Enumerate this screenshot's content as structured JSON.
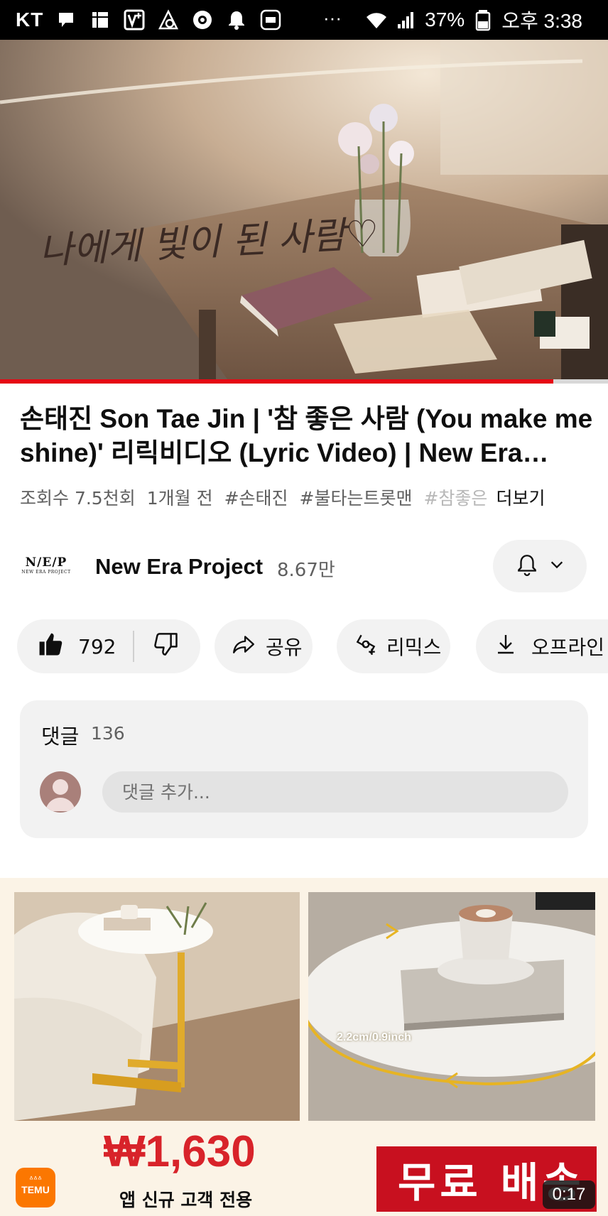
{
  "status_bar": {
    "carrier": "KT",
    "dots": "···",
    "battery": "37%",
    "time": "오후 3:38"
  },
  "video": {
    "overlay_text": "나에게 빛이 된 사람♡",
    "progress": 0.91
  },
  "title": "손태진 Son Tae Jin | '참 좋은 사람 (You make me shine)' 리릭비디오 (Lyric Video) | New Era Project",
  "meta": {
    "views": "조회수 7.5천회",
    "age": "1개월 전",
    "tags": [
      "#손태진",
      "#불타는트롯맨"
    ],
    "tag_faded": "#참좋은",
    "more": "더보기"
  },
  "channel": {
    "logo_text": "N/E/P",
    "logo_subtext": "NEW ERA PROJECT",
    "name": "New Era Project",
    "subscribers": "8.67만"
  },
  "actions": {
    "likes": "792",
    "share": "공유",
    "remix": "리믹스",
    "download": "오프라인"
  },
  "comments": {
    "label": "댓글",
    "count": "136",
    "placeholder": "댓글 추가..."
  },
  "ad": {
    "measure_label": "2.2cm/0.9inch",
    "brand": "TEMU",
    "brand_top": "ᐞᐞᐞ",
    "price": "₩1,630",
    "price_sub": "앱 신규 고객 전용",
    "shipping": "무료 배송",
    "timer": "0:17"
  },
  "colors": {
    "accent_red": "#e50914",
    "price_red": "#d8232a",
    "temu_orange": "#fb7701"
  }
}
